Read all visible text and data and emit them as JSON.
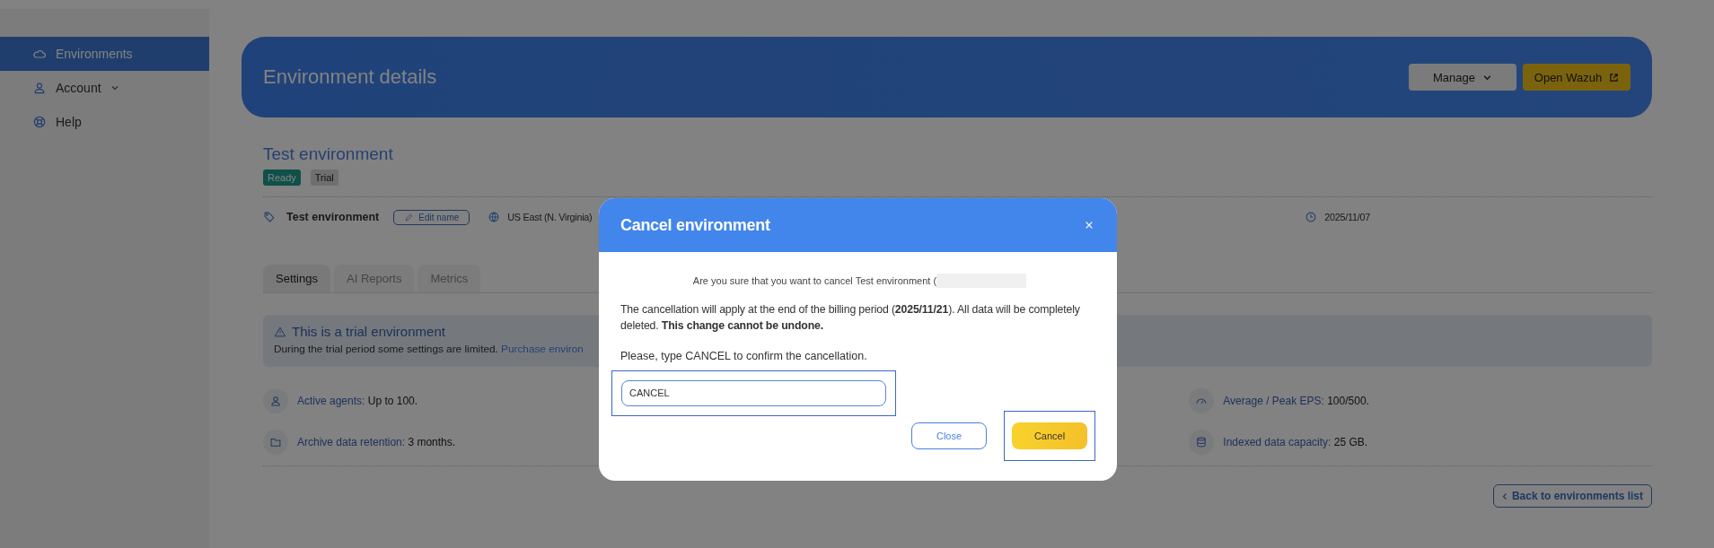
{
  "sidebar": {
    "items": [
      {
        "label": "Environments",
        "selected": true,
        "expandable": false
      },
      {
        "label": "Account",
        "selected": false,
        "expandable": true
      },
      {
        "label": "Help",
        "selected": false,
        "expandable": false
      }
    ]
  },
  "header": {
    "title": "Environment details",
    "buttons": [
      {
        "label": "Manage",
        "kind": "dropdown"
      },
      {
        "label": "Open Wazuh",
        "kind": "external"
      }
    ]
  },
  "environment": {
    "title": "Test environment",
    "badges": [
      {
        "label": "Ready",
        "kind": "status"
      },
      {
        "label": "Trial",
        "kind": "plan"
      }
    ],
    "info": [
      {
        "text": "Test environment",
        "action": "Edit name"
      },
      {
        "text": "US East (N. Virginia)"
      },
      {
        "text": "2025/11/07"
      }
    ]
  },
  "tabs": [
    {
      "label": "Settings",
      "selected": true
    },
    {
      "label": "AI Reports",
      "selected": false
    },
    {
      "label": "Metrics",
      "selected": false
    }
  ],
  "alert": {
    "title": "This is a trial environment",
    "text": "During the trial period some settings are limited.",
    "link": "Purchase environ"
  },
  "features": [
    {
      "label": "Active agents:",
      "value": "Up to 100."
    },
    {
      "label": "Average / Peak EPS:",
      "value": "100/500."
    },
    {
      "label": "Archive data retention:",
      "value": "3 months."
    },
    {
      "label": "Indexed data capacity:",
      "value": "25 GB."
    }
  ],
  "back_button": {
    "label": "Back to environments list"
  },
  "modal": {
    "title": "Cancel environment",
    "question": "Are you sure that you want to cancel Test environment (",
    "message": "The cancellation will apply at the end of the billing period (**2025/11/21**). All data will be completely deleted. **This change cannot be undone.**",
    "prompt": "Please, type CANCEL to confirm the cancellation.",
    "input": {
      "value": "CANCEL",
      "highlighted": true
    },
    "buttons": [
      {
        "label": "Close",
        "kind": "secondary",
        "highlighted": false
      },
      {
        "label": "Cancel",
        "kind": "primary",
        "highlighted": true
      }
    ]
  }
}
